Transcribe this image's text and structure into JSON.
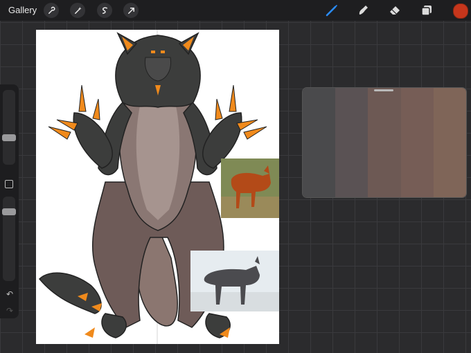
{
  "topbar": {
    "gallery_label": "Gallery",
    "actions": [
      "wrench-icon",
      "magic-wand-icon",
      "selection-icon",
      "transform-arrow-icon"
    ],
    "tools": [
      "brush-icon",
      "smudge-icon",
      "eraser-icon",
      "layers-icon"
    ],
    "active_tool": "brush-icon",
    "current_color": "#c6361c"
  },
  "sidebar": {
    "brush_size_level": 0.35,
    "opacity_level": 0.85,
    "undo_icon": "↶",
    "redo_icon": "↷"
  },
  "palette": {
    "swatches": [
      "#4a4a4c",
      "#5a5254",
      "#6d5954",
      "#765d56",
      "#7f6558"
    ]
  },
  "colors": {
    "accent_blue": "#2a8cff",
    "fur_dark": "#3c3d3c",
    "fur_brown": "#7b6661",
    "claw_orange": "#f08a1c"
  }
}
